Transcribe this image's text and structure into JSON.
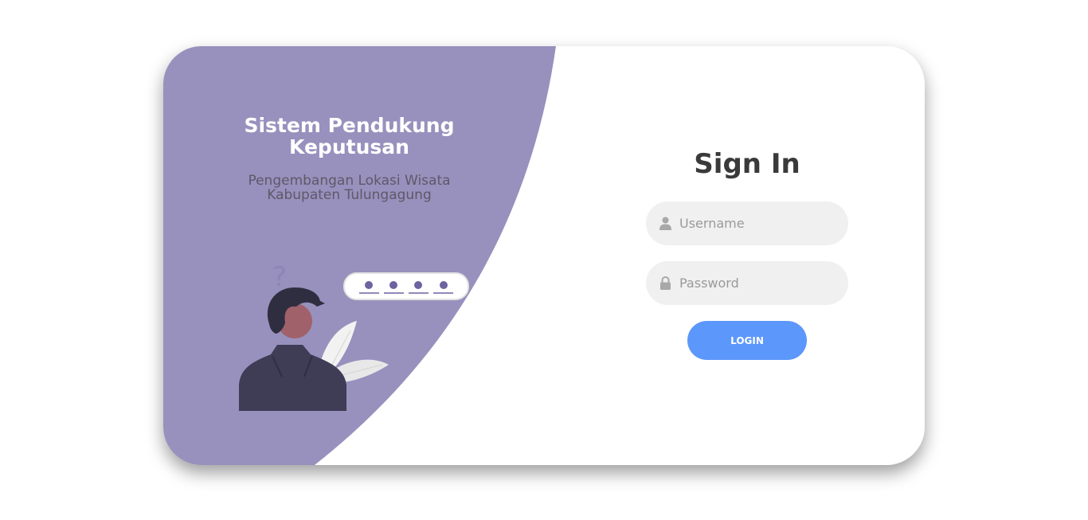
{
  "hero": {
    "title": "Sistem Pendukung Keputusan",
    "subtitle": "Pengembangan Lokasi Wisata Kabupaten Tulungagung"
  },
  "login": {
    "heading": "Sign In",
    "username_placeholder": "Username",
    "password_placeholder": "Password",
    "button_label": "LOGIN"
  },
  "illustration": {
    "question_mark": "?",
    "masked_password_dots": 4
  },
  "colors": {
    "panel": "#9891bd",
    "accent_button": "#5c97fb",
    "heading_text": "#3a3a3a",
    "field_bg": "#f0f0f0"
  },
  "icons": {
    "username": "user-icon",
    "password": "lock-icon"
  }
}
